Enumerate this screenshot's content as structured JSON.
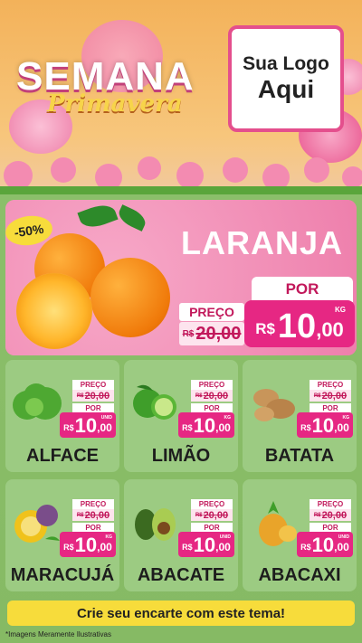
{
  "header": {
    "title": "SEMANA",
    "subtitle": "Primavera",
    "logo_line1": "Sua Logo",
    "logo_line2": "Aqui"
  },
  "hero": {
    "discount": "-50%",
    "name": "LARANJA",
    "preco_label": "PREÇO",
    "old_price": "20,00",
    "old_currency": "R$",
    "por_label": "POR",
    "currency": "R$",
    "price_int": "10",
    "price_cents": ",00",
    "unit": "KG"
  },
  "products": [
    {
      "name": "ALFACE",
      "preco_label": "PREÇO",
      "old_currency": "R$",
      "old_price": "20,00",
      "por_label": "POR",
      "currency": "R$",
      "price_int": "10",
      "price_cents": ",00",
      "unit": "UNID"
    },
    {
      "name": "LIMÃO",
      "preco_label": "PREÇO",
      "old_currency": "R$",
      "old_price": "20,00",
      "por_label": "POR",
      "currency": "R$",
      "price_int": "10",
      "price_cents": ",00",
      "unit": "KG"
    },
    {
      "name": "BATATA",
      "preco_label": "PREÇO",
      "old_currency": "R$",
      "old_price": "20,00",
      "por_label": "POR",
      "currency": "R$",
      "price_int": "10",
      "price_cents": ",00",
      "unit": "KG"
    },
    {
      "name": "MARACUJÁ",
      "preco_label": "PREÇO",
      "old_currency": "R$",
      "old_price": "20,00",
      "por_label": "POR",
      "currency": "R$",
      "price_int": "10",
      "price_cents": ",00",
      "unit": "KG"
    },
    {
      "name": "ABACATE",
      "preco_label": "PREÇO",
      "old_currency": "R$",
      "old_price": "20,00",
      "por_label": "POR",
      "currency": "R$",
      "price_int": "10",
      "price_cents": ",00",
      "unit": "UNID"
    },
    {
      "name": "ABACAXI",
      "preco_label": "PREÇO",
      "old_currency": "R$",
      "old_price": "20,00",
      "por_label": "POR",
      "currency": "R$",
      "price_int": "10",
      "price_cents": ",00",
      "unit": "UNID"
    }
  ],
  "footer": {
    "cta": "Crie seu encarte com este tema!",
    "disclaimer": "*Imagens Meramente Ilustrativas"
  },
  "colors": {
    "accent_pink": "#e62783",
    "banner_yellow": "#f7dc3b",
    "card_green": "#9ccb82"
  }
}
